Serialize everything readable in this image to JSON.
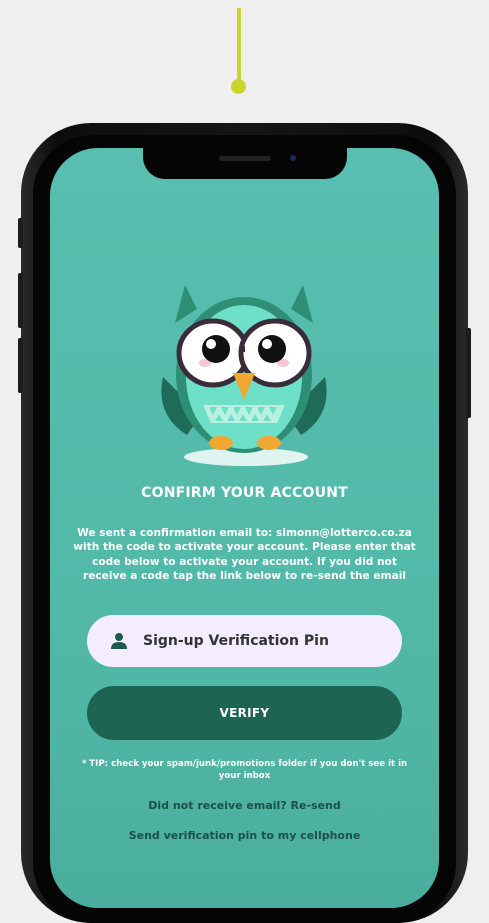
{
  "screen": {
    "title": "CONFIRM YOUR ACCOUNT",
    "description": "We sent a confirmation email to: simonn@lotterco.co.za with the code to activate your account. Please enter that code below to activate your account. If you did not receive a code tap the link below to re-send the email",
    "pin_input": {
      "placeholder": "Sign-up Verification Pin",
      "value": "",
      "icon": "person-icon"
    },
    "verify_label": "VERIFY",
    "tip": "* TIP: check your spam/junk/promotions folder if you don't see it in your inbox",
    "resend_link": "Did not receive email? Re-send",
    "cellphone_link": "Send verification pin to my cellphone"
  },
  "colors": {
    "background": "#efefef",
    "screen": "#52b9a9",
    "accent_pin": "#c9d42c",
    "input_bg": "#f4ecff",
    "button": "#1e6453",
    "link_text": "#1d5046"
  }
}
